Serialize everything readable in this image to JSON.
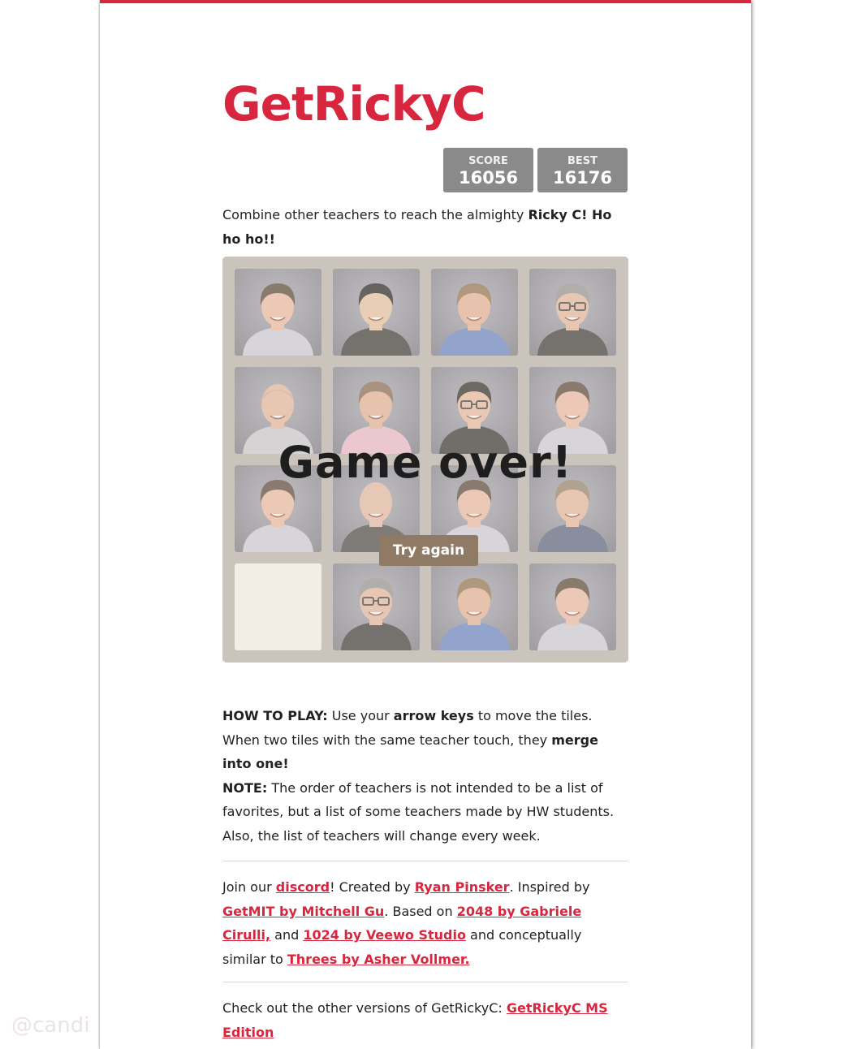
{
  "title": "GetRickyC",
  "scores": {
    "score_label": "SCORE",
    "score_value": "16056",
    "best_label": "BEST",
    "best_value": "16176"
  },
  "intro": {
    "text": "Combine other teachers to reach the almighty ",
    "bold": "Ricky C! Ho ho ho!!"
  },
  "game": {
    "over_message": "Game over!",
    "try_again_label": "Try again",
    "tiles": [
      {
        "row": 0,
        "col": 0,
        "shirt": "#c9ccd8",
        "hair": "#4a3a2c",
        "skin": "#e8b9a0",
        "bald": false,
        "glasses": false
      },
      {
        "row": 0,
        "col": 1,
        "shirt": "#2a2a2a",
        "hair": "#141414",
        "skin": "#e6c0a0",
        "bald": false,
        "glasses": false
      },
      {
        "row": 0,
        "col": 2,
        "shirt": "#5a7cc2",
        "hair": "#8a6a48",
        "skin": "#e3ae92",
        "bald": false,
        "glasses": false
      },
      {
        "row": 0,
        "col": 3,
        "shirt": "#2b2b2b",
        "hair": "#8c8c8c",
        "skin": "#e2b59c",
        "bald": false,
        "glasses": true
      },
      {
        "row": 1,
        "col": 0,
        "shirt": "#c6c9d0",
        "hair": "#b08a70",
        "skin": "#e3b39a",
        "bald": true,
        "glasses": false
      },
      {
        "row": 1,
        "col": 1,
        "shirt": "#e9b7c8",
        "hair": "#7a6048",
        "skin": "#e0ae90",
        "bald": false,
        "glasses": false
      },
      {
        "row": 1,
        "col": 2,
        "shirt": "#252525",
        "hair": "#1c1c1c",
        "skin": "#e6b89c",
        "bald": false,
        "glasses": true
      },
      {
        "row": 1,
        "col": 3,
        "shirt": "#c9ccd8",
        "hair": "#4a3a2c",
        "skin": "#e8b9a0",
        "bald": false,
        "glasses": false
      },
      {
        "row": 2,
        "col": 0,
        "shirt": "#c9ccd8",
        "hair": "#4a3a2c",
        "skin": "#e8b9a0",
        "bald": false,
        "glasses": false
      },
      {
        "row": 2,
        "col": 1,
        "shirt": "#3a3a3a",
        "hair": "#c8b8a8",
        "skin": "#e3b6a0",
        "bald": true,
        "glasses": false
      },
      {
        "row": 2,
        "col": 2,
        "shirt": "#c9ccd8",
        "hair": "#4a3a2c",
        "skin": "#e8b9a0",
        "bald": false,
        "glasses": false
      },
      {
        "row": 2,
        "col": 3,
        "shirt": "#4a5a78",
        "hair": "#8a7a62",
        "skin": "#e2b49a",
        "bald": false,
        "glasses": false
      },
      {
        "row": 3,
        "col": 0,
        "empty": true
      },
      {
        "row": 3,
        "col": 1,
        "shirt": "#2b2b2b",
        "hair": "#8c8c8c",
        "skin": "#e2b59c",
        "bald": false,
        "glasses": true
      },
      {
        "row": 3,
        "col": 2,
        "shirt": "#5a7cc2",
        "hair": "#8a6a48",
        "skin": "#e3ae92",
        "bald": false,
        "glasses": false
      },
      {
        "row": 3,
        "col": 3,
        "shirt": "#c9ccd8",
        "hair": "#4a3a2c",
        "skin": "#e8b9a0",
        "bald": false,
        "glasses": false
      }
    ]
  },
  "how_to_play": {
    "label": "HOW TO PLAY:",
    "text1": " Use your ",
    "bold1": "arrow keys",
    "text2": " to move the tiles. When two tiles with the same teacher touch, they ",
    "bold2": "merge into one!",
    "note_label": "NOTE:",
    "note_text": " The order of teachers is not intended to be a list of favorites, but a list of some teachers made by HW students. Also, the list of teachers will change every week."
  },
  "credits": {
    "t1": "Join our ",
    "discord": "discord",
    "t2": "! Created by ",
    "author": "Ryan Pinsker",
    "t3": ". Inspired by ",
    "getmit": "GetMIT by Mitchell Gu",
    "t4": ". Based on ",
    "g2048": "2048 by Gabriele Cirulli,",
    "t5": " and ",
    "g1024": "1024 by Veewo Studio",
    "t6": " and conceptually similar to ",
    "threes": "Threes by Asher Vollmer."
  },
  "other_versions": {
    "text": "Check out the other versions of GetRickyC: ",
    "link": "GetRickyC MS Edition"
  },
  "watermark": "@candi",
  "colors": {
    "accent": "#d7263d",
    "button": "#8f7a66",
    "score_bg": "#8a8a8a",
    "board": "#b5b0aa"
  }
}
